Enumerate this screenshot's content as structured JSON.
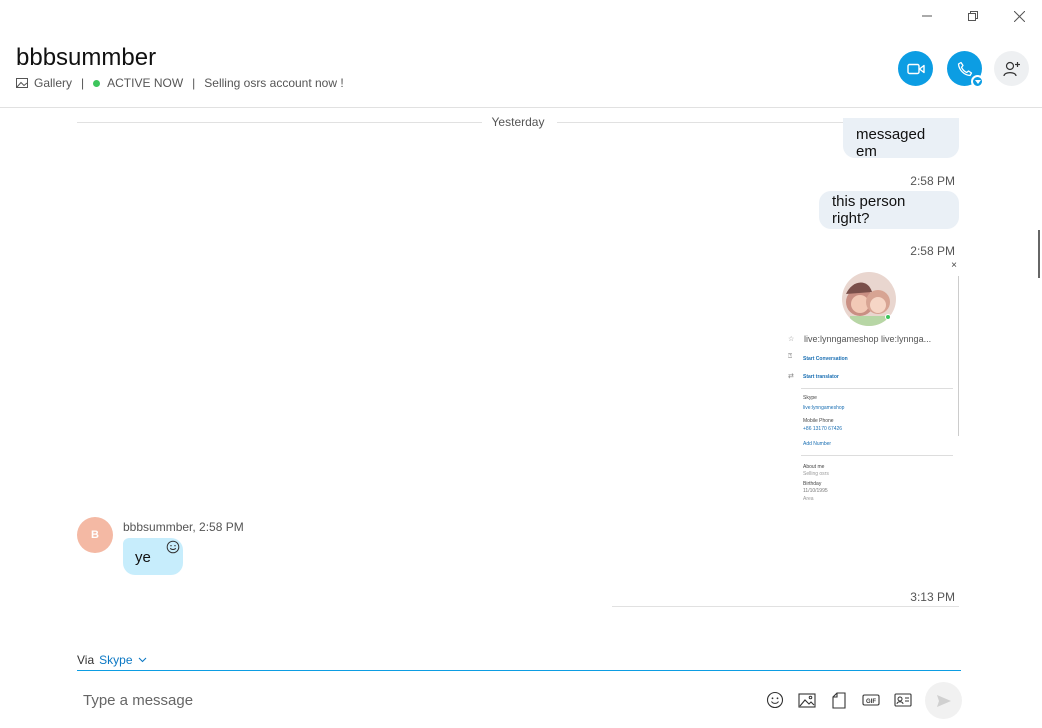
{
  "window": {
    "minimize_glyph": "—",
    "restore_glyph": "❐",
    "close_glyph": "✕"
  },
  "header": {
    "title": "bbbsummber",
    "gallery_label": "Gallery",
    "status": "ACTIVE NOW",
    "mood": "Selling osrs account now !",
    "separator": "|",
    "accent_color": "#0c9de3",
    "status_color": "#3dc55c"
  },
  "conversation": {
    "day_label": "Yesterday",
    "messages_out": [
      {
        "text": "messaged em",
        "time": "2:58 PM"
      },
      {
        "text": "this person right?",
        "time": "2:58 PM"
      }
    ],
    "shared_image": {
      "close_glyph": "×",
      "name_line": "live:lynngameshop live:lynnga...",
      "start_conversation": "Start Conversation",
      "start_translator": "Start translator",
      "skype_label": "Skype",
      "skype_value": "live:lynngameshop",
      "mobile_label": "Mobile Phone",
      "mobile_value": "+86 13170 67426",
      "add_number": "Add Number",
      "about_label": "About me",
      "about_value": "Selling osrs",
      "birthday_label": "Birthday",
      "birthday_value": "11/10/1995",
      "extra": "Area"
    },
    "incoming": {
      "avatar_initial": "B",
      "sender": "bbbsummber",
      "time": "2:58 PM",
      "sender_line": "bbbsummber, 2:58 PM",
      "text": "ye"
    },
    "last_time": "3:13 PM"
  },
  "composer": {
    "via_label": "Via",
    "service": "Skype",
    "placeholder": "Type a message"
  },
  "icons": [
    "gallery-icon",
    "video-call-icon",
    "audio-call-icon",
    "add-person-icon",
    "smiley-icon",
    "image-icon",
    "file-icon",
    "gif-icon",
    "contact-card-icon",
    "send-icon",
    "chevron-down-icon"
  ]
}
